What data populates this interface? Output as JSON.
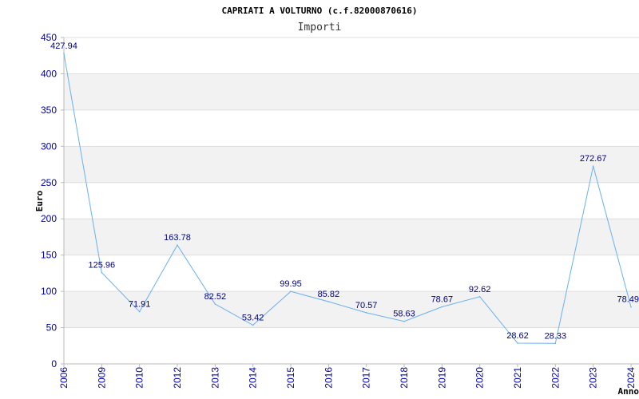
{
  "colors": {
    "line": "#6ab0ee",
    "band": "#f2f2f2",
    "grid": "#dddddd",
    "axis": "#bbbbbb",
    "tick_text": "#0000aa",
    "label_text": "#000080"
  },
  "chart_data": {
    "type": "line",
    "title": "CAPRIATI A VOLTURNO (c.f.82000870616)",
    "subtitle": "Importi",
    "xlabel": "Anno",
    "ylabel": "Euro",
    "ylim": [
      0,
      450
    ],
    "yticks": [
      0,
      50,
      100,
      150,
      200,
      250,
      300,
      350,
      400,
      450
    ],
    "grid": true,
    "categories": [
      "2006",
      "2009",
      "2010",
      "2012",
      "2013",
      "2014",
      "2015",
      "2016",
      "2017",
      "2018",
      "2019",
      "2020",
      "2021",
      "2022",
      "2023",
      "2024"
    ],
    "series": [
      {
        "values": [
          427.94,
          125.96,
          71.91,
          163.78,
          82.52,
          53.42,
          99.95,
          85.82,
          70.57,
          58.63,
          78.67,
          92.62,
          28.62,
          28.33,
          272.67,
          78.49
        ],
        "labels": [
          "427.94",
          "125.96",
          "71.91",
          "163.78",
          "82.52",
          "53.42",
          "99.95",
          "85.82",
          "70.57",
          "58.63",
          "78.67",
          "92.62",
          "28.62",
          "28.33",
          "272.67",
          "78.49"
        ]
      }
    ]
  }
}
